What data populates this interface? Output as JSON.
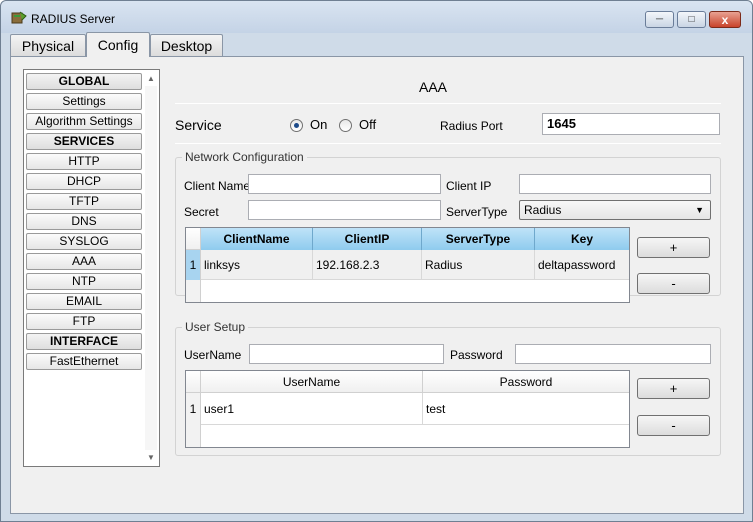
{
  "window": {
    "title": "RADIUS Server",
    "minimize": "─",
    "maximize": "□",
    "close": "x"
  },
  "tabs": [
    {
      "label": "Physical",
      "active": false
    },
    {
      "label": "Config",
      "active": true
    },
    {
      "label": "Desktop",
      "active": false
    }
  ],
  "sidebar": {
    "items": [
      {
        "label": "GLOBAL",
        "header": true
      },
      {
        "label": "Settings",
        "header": false
      },
      {
        "label": "Algorithm Settings",
        "header": false
      },
      {
        "label": "SERVICES",
        "header": true
      },
      {
        "label": "HTTP",
        "header": false
      },
      {
        "label": "DHCP",
        "header": false
      },
      {
        "label": "TFTP",
        "header": false
      },
      {
        "label": "DNS",
        "header": false
      },
      {
        "label": "SYSLOG",
        "header": false
      },
      {
        "label": "AAA",
        "header": false
      },
      {
        "label": "NTP",
        "header": false
      },
      {
        "label": "EMAIL",
        "header": false
      },
      {
        "label": "FTP",
        "header": false
      },
      {
        "label": "INTERFACE",
        "header": true
      },
      {
        "label": "FastEthernet",
        "header": false
      }
    ]
  },
  "main": {
    "title": "AAA",
    "service": {
      "label": "Service",
      "on_label": "On",
      "off_label": "Off",
      "selected": "On"
    },
    "radius_port": {
      "label": "Radius Port",
      "value": "1645"
    },
    "network": {
      "legend": "Network Configuration",
      "client_name_label": "Client Name",
      "client_name_value": "",
      "client_ip_label": "Client IP",
      "client_ip_value": "",
      "secret_label": "Secret",
      "secret_value": "",
      "server_type_label": "ServerType",
      "server_type_value": "Radius",
      "columns": [
        "ClientName",
        "ClientIP",
        "ServerType",
        "Key"
      ],
      "rows": [
        {
          "num": "1",
          "cells": [
            "linksys",
            "192.168.2.3",
            "Radius",
            "deltapassword"
          ]
        }
      ],
      "add_label": "+",
      "remove_label": "-"
    },
    "user": {
      "legend": "User Setup",
      "username_label": "UserName",
      "username_value": "",
      "password_label": "Password",
      "password_value": "",
      "columns": [
        "UserName",
        "Password"
      ],
      "rows": [
        {
          "num": "1",
          "cells": [
            "user1",
            "test"
          ]
        }
      ],
      "add_label": "+",
      "remove_label": "-"
    }
  },
  "colors": {
    "accent": "#8fcbee",
    "window_frame": "#cfdbe8",
    "close_button": "#c9432a"
  },
  "icons": {
    "app": "server-icon",
    "radio_on": "radio-selected-icon"
  }
}
